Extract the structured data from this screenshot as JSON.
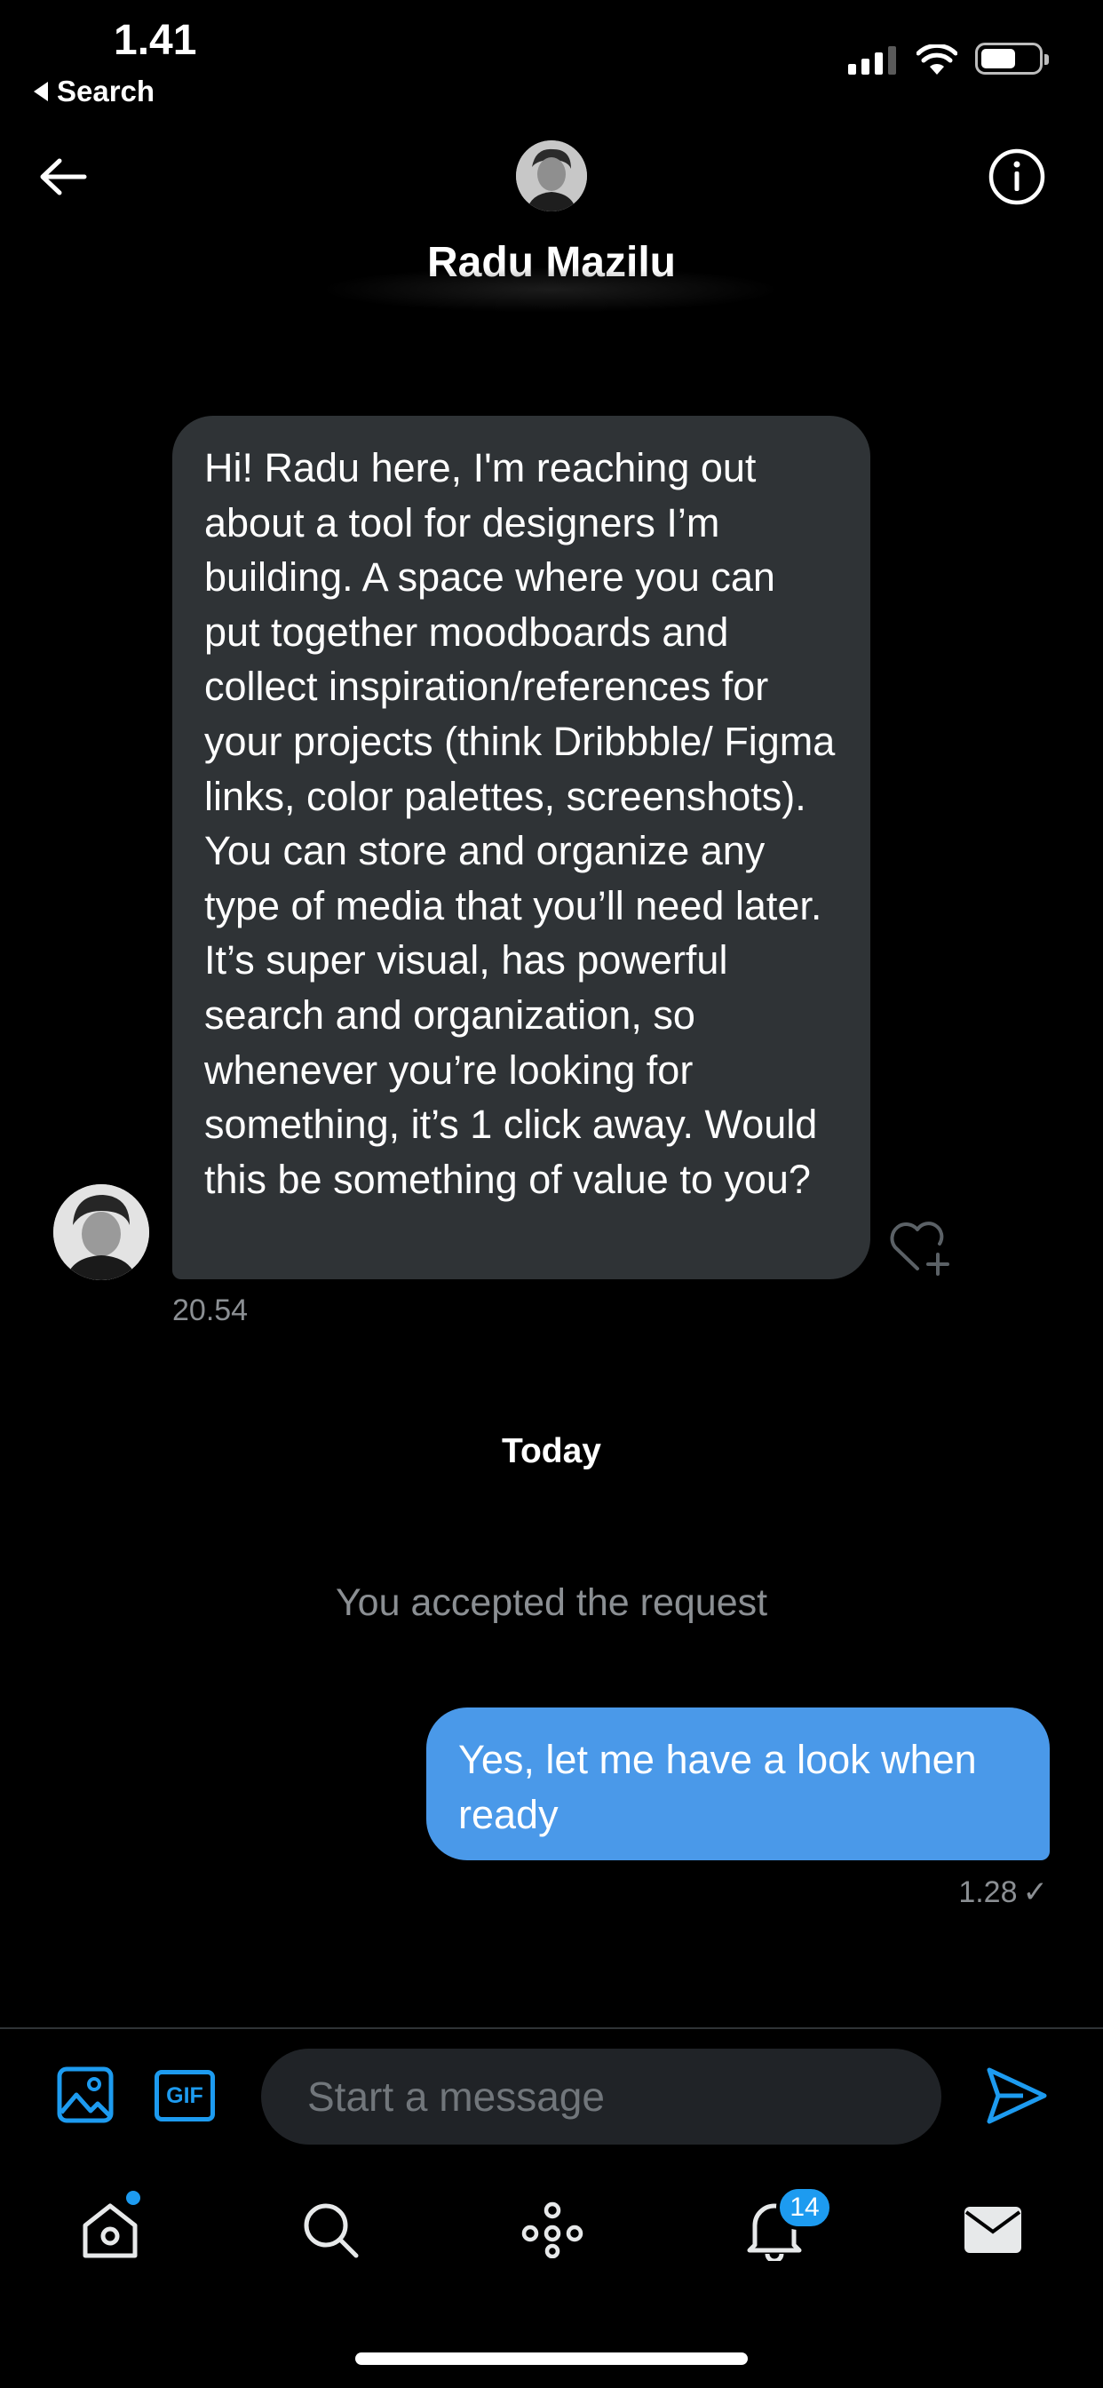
{
  "status_bar": {
    "time": "1.41",
    "back_app": "Search"
  },
  "header": {
    "contact_name": "Radu Mazilu"
  },
  "messages": {
    "incoming": {
      "text": "Hi! Radu here, I'm reaching out about a tool for designers I’m building. A  space where you can put together moodboards and collect inspiration/references for your projects (think Dribbble/ Figma links, color palettes, screenshots). You can store and organize any type of media that you’ll need later. It’s super visual, has powerful search and organization, so whenever you’re looking for something, it’s 1 click away. Would this be something of value to you?",
      "time": "20.54"
    },
    "day_separator": "Today",
    "system_notice": "You accepted the request",
    "outgoing": {
      "text": "Yes, let me have a look when ready",
      "time": "1.28",
      "status_glyph": "✓"
    }
  },
  "composer": {
    "placeholder": "Start a message",
    "gif_label": "GIF"
  },
  "tab_bar": {
    "notifications_badge": "14"
  },
  "colors": {
    "accent": "#1d9bf0",
    "outgoing_bubble": "#4a99e9",
    "incoming_bubble": "#2f3336",
    "background": "#000000"
  }
}
